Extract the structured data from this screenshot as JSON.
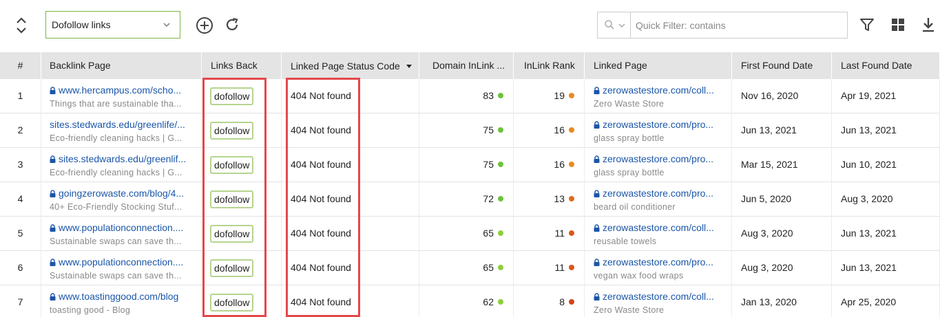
{
  "toolbar": {
    "filter_select_value": "Dofollow links",
    "search_placeholder": "Quick Filter: contains"
  },
  "table": {
    "columns": [
      "#",
      "Backlink Page",
      "Links Back",
      "Linked Page Status Code",
      "Domain InLink ...",
      "InLink Rank",
      "Linked Page",
      "First Found Date",
      "Last Found Date"
    ],
    "sorted_column": "Linked Page Status Code",
    "rows": [
      {
        "index": "1",
        "backlink_url": "www.hercampus.com/scho...",
        "backlink_title": "Things that are sustainable tha...",
        "backlink_secure": true,
        "links_back": "dofollow",
        "status": "404 Not found",
        "domain_inlink": "83",
        "domain_dot": "#6cc33a",
        "inlink_rank": "19",
        "rank_dot": "#e88a22",
        "linked_url": "zerowastestore.com/coll...",
        "linked_title": "Zero Waste Store",
        "first_found": "Nov 16, 2020",
        "last_found": "Apr 19, 2021"
      },
      {
        "index": "2",
        "backlink_url": "sites.stedwards.edu/greenlife/...",
        "backlink_title": "Eco-friendly cleaning hacks | G...",
        "backlink_secure": false,
        "links_back": "dofollow",
        "status": "404 Not found",
        "domain_inlink": "75",
        "domain_dot": "#6cc33a",
        "inlink_rank": "16",
        "rank_dot": "#e88a22",
        "linked_url": "zerowastestore.com/pro...",
        "linked_title": "glass spray bottle",
        "first_found": "Jun 13, 2021",
        "last_found": "Jun 13, 2021"
      },
      {
        "index": "3",
        "backlink_url": "sites.stedwards.edu/greenlif...",
        "backlink_title": "Eco-friendly cleaning hacks | G...",
        "backlink_secure": true,
        "links_back": "dofollow",
        "status": "404 Not found",
        "domain_inlink": "75",
        "domain_dot": "#6cc33a",
        "inlink_rank": "16",
        "rank_dot": "#e88a22",
        "linked_url": "zerowastestore.com/pro...",
        "linked_title": "glass spray bottle",
        "first_found": "Mar 15, 2021",
        "last_found": "Jun 10, 2021"
      },
      {
        "index": "4",
        "backlink_url": "goingzerowaste.com/blog/4...",
        "backlink_title": "40+ Eco-Friendly Stocking Stuf...",
        "backlink_secure": true,
        "links_back": "dofollow",
        "status": "404 Not found",
        "domain_inlink": "72",
        "domain_dot": "#6cc33a",
        "inlink_rank": "13",
        "rank_dot": "#dd6a20",
        "linked_url": "zerowastestore.com/pro...",
        "linked_title": "beard oil conditioner",
        "first_found": "Jun 5, 2020",
        "last_found": "Aug 3, 2020"
      },
      {
        "index": "5",
        "backlink_url": "www.populationconnection....",
        "backlink_title": "Sustainable swaps can save th...",
        "backlink_secure": true,
        "links_back": "dofollow",
        "status": "404 Not found",
        "domain_inlink": "65",
        "domain_dot": "#8ccf3a",
        "inlink_rank": "11",
        "rank_dot": "#d9561e",
        "linked_url": "zerowastestore.com/coll...",
        "linked_title": "reusable towels",
        "first_found": "Aug 3, 2020",
        "last_found": "Jun 13, 2021"
      },
      {
        "index": "6",
        "backlink_url": "www.populationconnection....",
        "backlink_title": "Sustainable swaps can save th...",
        "backlink_secure": true,
        "links_back": "dofollow",
        "status": "404 Not found",
        "domain_inlink": "65",
        "domain_dot": "#8ccf3a",
        "inlink_rank": "11",
        "rank_dot": "#d9561e",
        "linked_url": "zerowastestore.com/pro...",
        "linked_title": "vegan wax food wraps",
        "first_found": "Aug 3, 2020",
        "last_found": "Jun 13, 2021"
      },
      {
        "index": "7",
        "backlink_url": "www.toastinggood.com/blog",
        "backlink_title": "toasting good - Blog",
        "backlink_secure": true,
        "links_back": "dofollow",
        "status": "404 Not found",
        "domain_inlink": "62",
        "domain_dot": "#8ccf3a",
        "inlink_rank": "8",
        "rank_dot": "#d0451c",
        "linked_url": "zerowastestore.com/coll...",
        "linked_title": "Zero Waste Store",
        "first_found": "Jan 13, 2020",
        "last_found": "Apr 25, 2020"
      }
    ]
  },
  "colors": {
    "accent_green": "#7cb342",
    "link_blue": "#1a56a8",
    "highlight_red": "#e4484b",
    "header_bg": "#e4e4e4"
  },
  "icons": [
    "expand-collapse-icon",
    "chevron-down-icon",
    "add-circle-icon",
    "refresh-icon",
    "search-icon",
    "filter-icon",
    "grid-view-icon",
    "download-icon",
    "lock-icon",
    "sort-desc-icon"
  ]
}
